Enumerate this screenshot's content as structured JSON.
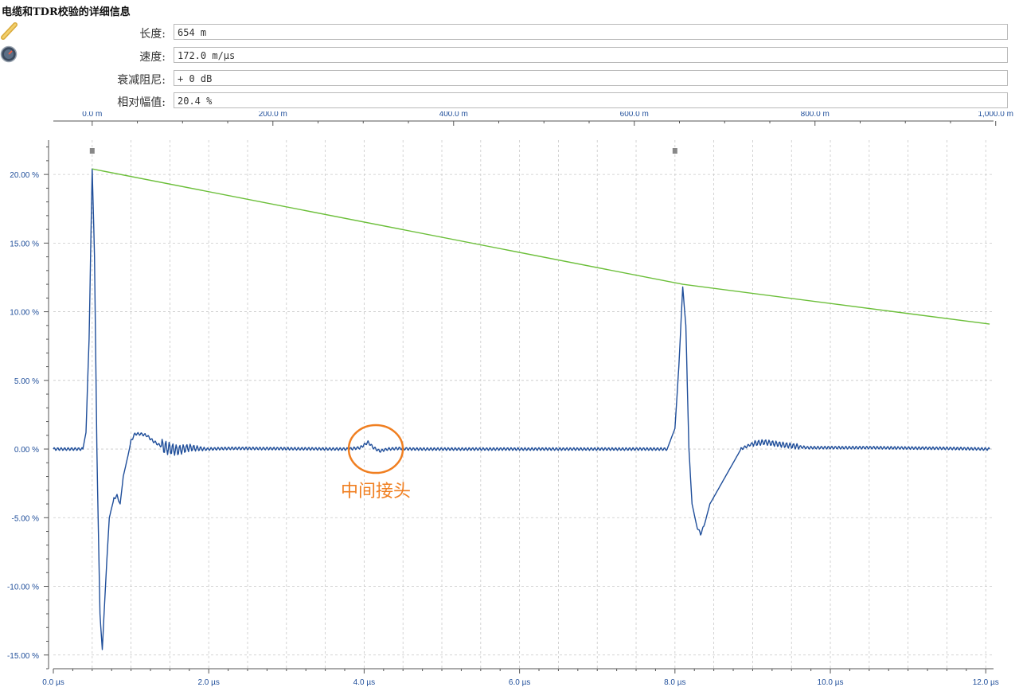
{
  "header": {
    "title": "电缆和TDR校验的详细信息"
  },
  "icons": [
    "ruler-icon",
    "speedometer-icon"
  ],
  "fields": [
    {
      "label": "长度:",
      "value": "654 m"
    },
    {
      "label": "速度:",
      "value": "172.0 m/µs"
    },
    {
      "label": "衰减阻尼:",
      "value": "+ 0 dB"
    },
    {
      "label": "相对幅值:",
      "value": "20.4 %"
    }
  ],
  "colors": {
    "waveform": "#1f4e9a",
    "attenuation": "#6cbf3a",
    "annotation": "#f07f21",
    "axis_text": "#1f4e9a",
    "grid": "#c8c8c8"
  },
  "chart_data": {
    "type": "line",
    "x_axis_bottom": {
      "unit": "µs",
      "range": [
        0,
        12.1
      ],
      "tick_labels": [
        "0.0 µs",
        "2.0 µs",
        "4.0 µs",
        "6.0 µs",
        "8.0 µs",
        "10.0 µs",
        "12.0 µs"
      ],
      "tick_values": [
        0,
        2,
        4,
        6,
        8,
        10,
        12
      ]
    },
    "x_axis_top": {
      "unit": "m",
      "tick_labels": [
        "0.0 m",
        "200.0 m",
        "400.0 m",
        "600.0 m",
        "800.0 m",
        "1,000.0 m"
      ],
      "tick_values_m": [
        0,
        200,
        400,
        600,
        800,
        1000
      ]
    },
    "y_axis": {
      "unit": "%",
      "range": [
        -16.0,
        22.5
      ],
      "tick_labels": [
        "20.00 %",
        "15.00 %",
        "10.00 %",
        "5.00 %",
        "0.00 %",
        "-5.00 %",
        "-10.00 %",
        "-15.00 %"
      ],
      "tick_values": [
        20,
        15,
        10,
        5,
        0,
        -5,
        -10,
        -15
      ]
    },
    "grid": true,
    "cursors_us": [
      0.5,
      8.0
    ],
    "series": [
      {
        "kind": "waveform",
        "x": [
          0,
          0.38,
          0.42,
          0.46,
          0.5,
          0.53,
          0.56,
          0.6,
          0.63,
          0.68,
          0.72,
          0.78,
          0.82,
          0.86,
          0.9,
          0.96,
          1.0,
          1.05,
          1.12,
          1.2,
          1.28,
          1.36,
          1.45,
          1.6,
          1.75,
          1.95,
          2.3,
          3.8,
          3.95,
          4.05,
          4.12,
          4.2,
          4.3,
          4.45,
          4.6,
          7.9,
          8.0,
          8.05,
          8.1,
          8.14,
          8.18,
          8.22,
          8.28,
          8.33,
          8.38,
          8.45,
          8.55,
          8.7,
          8.85,
          9.0,
          9.15,
          9.4,
          9.7,
          10.5,
          11.5,
          12.05
        ],
        "y": [
          0,
          0,
          1.2,
          8,
          20.4,
          14,
          0,
          -12,
          -14.6,
          -9,
          -5,
          -3.6,
          -3.4,
          -4,
          -2,
          -0.5,
          0.6,
          1.1,
          1.1,
          1,
          0.6,
          0.3,
          0.1,
          -0.1,
          0.1,
          0,
          0.05,
          0,
          0.1,
          0.5,
          0.1,
          -0.15,
          0,
          0.05,
          0,
          0,
          1.5,
          6,
          11.8,
          9,
          0,
          -4,
          -5.6,
          -6.2,
          -5.5,
          -4,
          -3,
          -1.5,
          0,
          0.4,
          0.5,
          0.3,
          0.1,
          0.1,
          0.05,
          0
        ]
      },
      {
        "kind": "attenuation",
        "x": [
          0.5,
          8.1,
          12.05
        ],
        "y": [
          20.4,
          12.0,
          9.1
        ]
      }
    ],
    "annotations": [
      {
        "text": "中间接头",
        "x": 4.15,
        "y": 0
      }
    ]
  }
}
